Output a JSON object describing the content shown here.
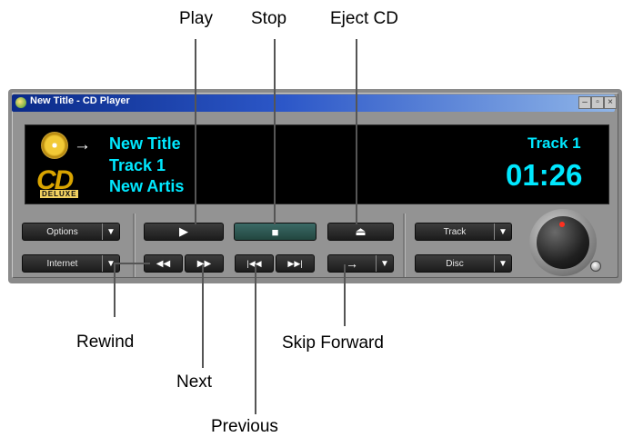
{
  "window": {
    "title": "New Title - CD Player",
    "controls": [
      "minimize",
      "restore",
      "close"
    ]
  },
  "display": {
    "artist_line_title": "New Title",
    "track_line": "Track 1",
    "artist_line": "New Artis",
    "logo_text": "CD",
    "logo_subtext": "DELUXE",
    "track_label": "Track 1",
    "time": "01:26"
  },
  "buttons": {
    "options": "Options",
    "internet": "Internet",
    "track": "Track",
    "disc": "Disc",
    "play_symbol": "▶",
    "stop_symbol": "■",
    "eject_symbol": "⏏",
    "rewind_symbol": "◀◀",
    "fastforward_symbol": "▶▶",
    "previous_symbol": "|◀◀",
    "next_symbol": "▶▶|",
    "skip_symbol": "→",
    "dropdown_arrow": "▼"
  },
  "callouts": {
    "play": "Play",
    "stop": "Stop",
    "eject": "Eject CD",
    "rewind": "Rewind",
    "next": "Next",
    "previous": "Previous",
    "skip_forward": "Skip Forward"
  }
}
